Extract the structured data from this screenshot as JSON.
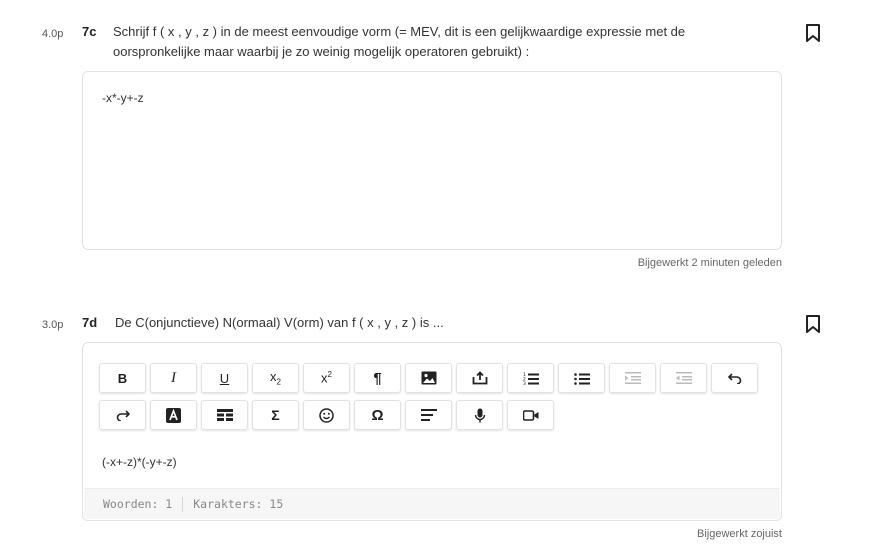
{
  "q7c": {
    "points": "4.0p",
    "number": "7c",
    "text_line1": "Schrijf f ( x , y , z ) in de meest eenvoudige vorm (= MEV, dit is een gelijkwaardige expressie met de",
    "text_line2": "oorspronkelijke maar waarbij je zo weinig mogelijk operatoren gebruikt) :",
    "answer": "-x*-y+-z",
    "updated": "Bijgewerkt 2 minuten geleden",
    "bookmark_icon": "bookmark-icon"
  },
  "q7d": {
    "points": "3.0p",
    "number": "7d",
    "text": "De C(onjunctieve) N(ormaal) V(orm) van f ( x , y , z ) is ...",
    "answer": "(-x+-z)*(-y+-z)",
    "updated": "Bijgewerkt zojuist",
    "bookmark_icon": "bookmark-icon",
    "word_count": "Woorden: 1",
    "char_count": "Karakters: 15"
  },
  "toolbar": {
    "bold": "B",
    "italic": "I",
    "underline": "U",
    "subscript": "x",
    "subscript_mark": "2",
    "superscript": "x",
    "superscript_mark": "2",
    "paragraph": "¶",
    "sigma": "Σ",
    "omega": "Ω",
    "icons": [
      "bold-icon",
      "italic-icon",
      "underline-icon",
      "subscript-icon",
      "superscript-icon",
      "paragraph-icon",
      "image-icon",
      "upload-icon",
      "numbered-list-icon",
      "bulleted-list-icon",
      "indent-icon",
      "outdent-icon",
      "undo-icon",
      "redo-icon",
      "text-color-icon",
      "table-icon",
      "sigma-icon",
      "emoji-icon",
      "omega-icon",
      "align-icon",
      "microphone-icon",
      "video-icon"
    ]
  },
  "colors": {
    "text": "#2b2b2b",
    "border": "#e3e3e3",
    "disabled": "#b8b8b8",
    "footer_bg": "#f6f6f6"
  }
}
